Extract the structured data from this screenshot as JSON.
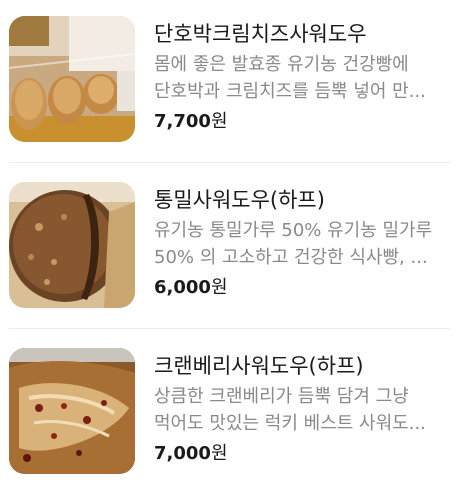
{
  "products": [
    {
      "name": "단호박크림치즈사워도우",
      "desc_line1": "몸에 좋은 발효종 유기농 건강빵에",
      "desc_line2": "단호박과 크림치즈를 듬뿍 넣어 만...",
      "price_amount": "7,700",
      "price_unit": "원",
      "image_icon": "bread-display-photo"
    },
    {
      "name": "통밀사워도우(하프)",
      "desc_line1": "유기농 통밀가루 50% 유기농 밀가루",
      "desc_line2": "50% 의 고소하고 건강한 식사빵, ...",
      "price_amount": "6,000",
      "price_unit": "원",
      "image_icon": "wholewheat-loaf-photo"
    },
    {
      "name": "크랜베리사워도우(하프)",
      "desc_line1": "상큼한 크랜베리가 듬뿍 담겨 그냥",
      "desc_line2": "먹어도 맛있는 럭키 베스트 사워도...",
      "price_amount": "7,000",
      "price_unit": "원",
      "image_icon": "cranberry-bread-photo"
    }
  ]
}
